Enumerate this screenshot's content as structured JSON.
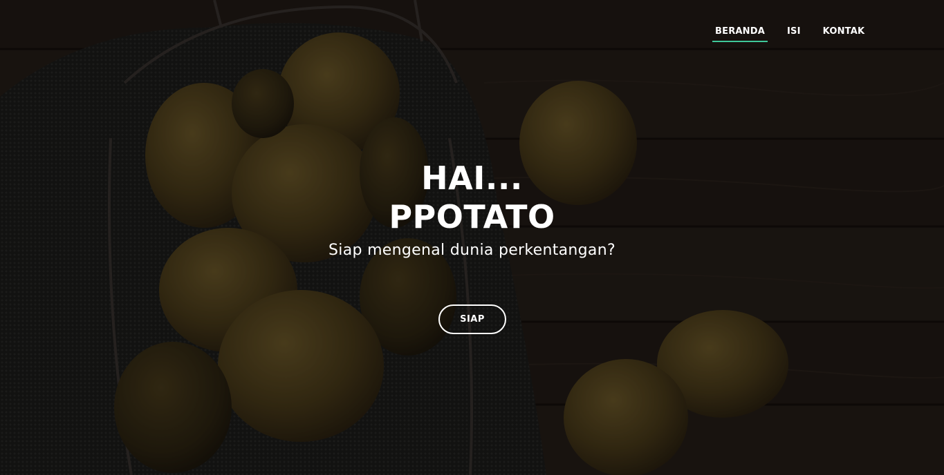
{
  "nav": {
    "items": [
      {
        "label": "BERANDA",
        "active": true
      },
      {
        "label": "ISI",
        "active": false
      },
      {
        "label": "KONTAK",
        "active": false
      }
    ],
    "active_underline_color": "#3fc79a"
  },
  "hero": {
    "title_line1": "HAI...",
    "title_line2": "PPOTATO",
    "subtitle": "Siap mengenal dunia perkentangan?",
    "cta_label": "SIAP",
    "background": "dark wooden table with potatoes in a wire basket on burlap"
  }
}
